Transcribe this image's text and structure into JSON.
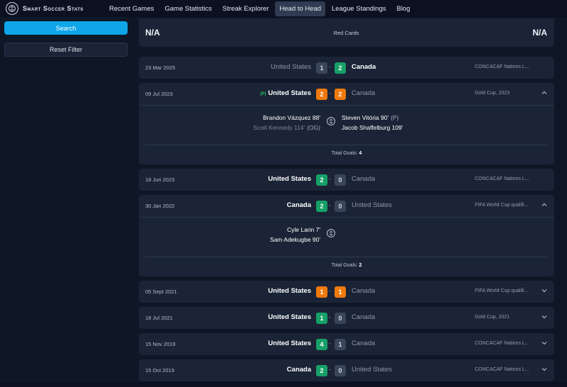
{
  "brand": {
    "name": "Smart Soccer Stats",
    "icon": "soccer-ball-icon"
  },
  "nav": [
    {
      "label": "Recent Games",
      "active": false
    },
    {
      "label": "Game Statistics",
      "active": false
    },
    {
      "label": "Streak Explorer",
      "active": false
    },
    {
      "label": "Head to Head",
      "active": true
    },
    {
      "label": "League Standings",
      "active": false
    },
    {
      "label": "Blog",
      "active": false
    }
  ],
  "sidebar": {
    "search_label": "Search",
    "reset_label": "Reset Filter"
  },
  "stats_row": {
    "left": "N/A",
    "label": "Red Cards",
    "right": "N/A"
  },
  "matches": [
    {
      "date": "23 Mar 2025",
      "home": "United States",
      "home_score": "1",
      "away_score": "2",
      "away": "Canada",
      "competition": "CONCACAF Nations L...",
      "result": "away"
    },
    {
      "date": "09 Jul 2023",
      "pen_tag": "(P)",
      "home": "United States",
      "home_score": "2",
      "away_score": "2",
      "away": "Canada",
      "competition": "Gold Cup, 2023",
      "result": "draw",
      "goals_home": [
        {
          "text": "Brandon Vázquez 88'"
        },
        {
          "text": "Scott Kennedy 114'",
          "tag": "(OG)"
        }
      ],
      "goals_away": [
        {
          "text": "Steven Vitória 90'",
          "tag": "(P)"
        },
        {
          "text": "Jacob Shaffelburg 109'"
        }
      ],
      "total_label": "Total Goals:",
      "total_value": "4"
    },
    {
      "date": "18 Jun 2023",
      "home": "United States",
      "home_score": "2",
      "away_score": "0",
      "away": "Canada",
      "competition": "CONCACAF Nations L...",
      "result": "home"
    },
    {
      "date": "30 Jan 2022",
      "home": "Canada",
      "home_score": "2",
      "away_score": "0",
      "away": "United States",
      "competition": "FIFA World Cup qualifi...",
      "result": "home",
      "goals_home": [
        {
          "text": "Cyle Larin 7'"
        },
        {
          "text": "Sam Adekugbe 90'"
        }
      ],
      "total_label": "Total Goals:",
      "total_value": "2"
    },
    {
      "date": "05 Sept 2021",
      "home": "United States",
      "home_score": "1",
      "away_score": "1",
      "away": "Canada",
      "competition": "FIFA World Cup qualifi...",
      "result": "draw"
    },
    {
      "date": "18 Jul 2021",
      "home": "United States",
      "home_score": "1",
      "away_score": "0",
      "away": "Canada",
      "competition": "Gold Cup, 2021",
      "result": "home"
    },
    {
      "date": "15 Nov 2019",
      "home": "United States",
      "home_score": "4",
      "away_score": "1",
      "away": "Canada",
      "competition": "CONCACAF Nations L...",
      "result": "home"
    },
    {
      "date": "15 Oct 2019",
      "home": "Canada",
      "home_score": "2",
      "away_score": "0",
      "away": "United States",
      "competition": "CONCACAF Nations L...",
      "result": "home"
    }
  ],
  "colors": {
    "win": "#16a067",
    "draw": "#f07a0c",
    "lose": "#3a4559",
    "accent": "#0ea5e9"
  }
}
